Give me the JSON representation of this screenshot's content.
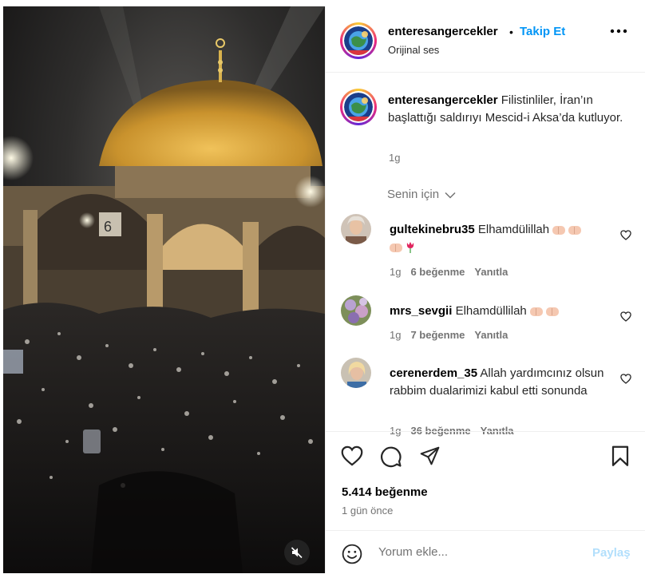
{
  "post": {
    "username": "enteresangercekler",
    "separator": "•",
    "follow_label": "Takip Et",
    "audio": "Orijinal ses",
    "more_icon": "more-horizontal-icon",
    "caption": "Filistinliler, İran’ın başlattığı saldırıyı Mescid-i Aksa’da kutluyor.",
    "caption_time": "1g"
  },
  "comments_header": {
    "label": "Senin için"
  },
  "comments": [
    {
      "username": "gultekinebru35",
      "text": "Elhamdülillah",
      "time": "1g",
      "likes": "6 beğenme",
      "reply": "Yanıtla"
    },
    {
      "username": "mrs_sevgii",
      "text": "Elhamdüllilah",
      "time": "1g",
      "likes": "7 beğenme",
      "reply": "Yanıtla"
    },
    {
      "username": "cerenerdem_35",
      "text": "Allah yardımcınız olsun rabbim dualarimizi kabul etti sonunda",
      "time": "1g",
      "likes": "36 beğenme",
      "reply": "Yanıtla"
    }
  ],
  "stats": {
    "likes": "5.414 beğenme",
    "posted": "1 gün önce"
  },
  "comment_box": {
    "placeholder": "Yorum ekle...",
    "post_label": "Paylaş"
  },
  "colors": {
    "accent": "#0095f6",
    "muted": "#737373",
    "post_disabled": "#b2dffc"
  }
}
